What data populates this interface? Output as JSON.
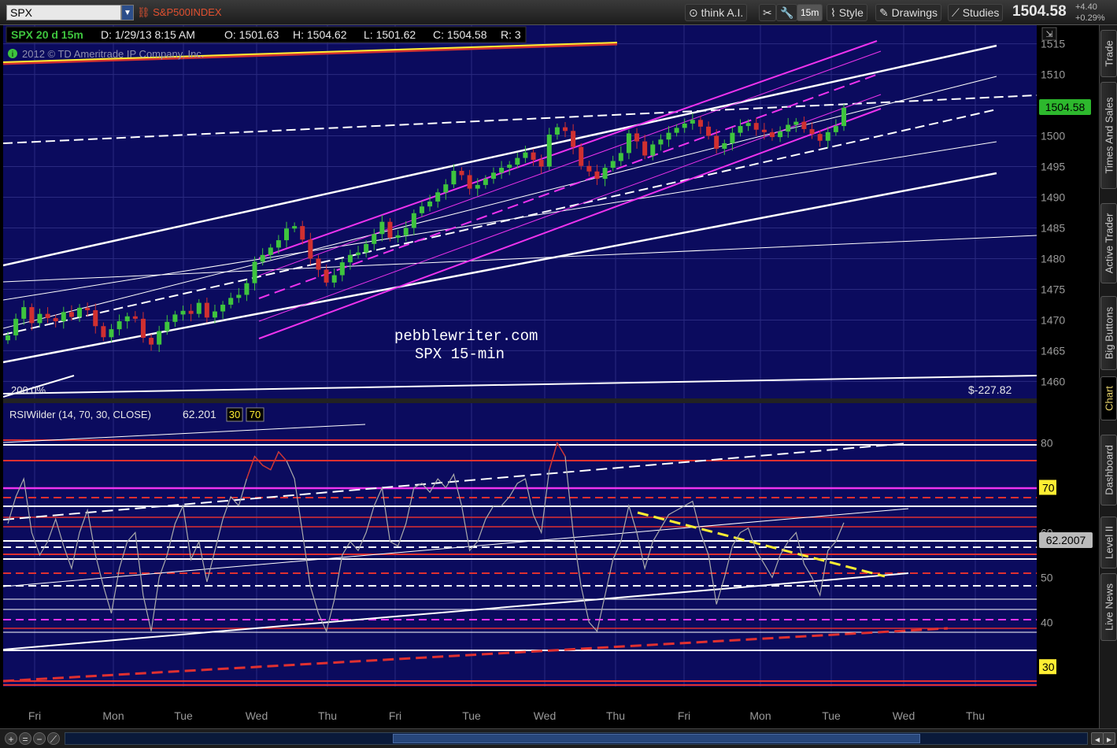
{
  "toolbar": {
    "symbol": "SPX",
    "symbol_description": "S&P500INDEX",
    "think_ai": "think A.I.",
    "interval": "15m",
    "style": "Style",
    "drawings": "Drawings",
    "studies": "Studies",
    "last_price": "1504.58",
    "change_abs": "+4.40",
    "change_pct": "+0.29%"
  },
  "price_header": {
    "label": "SPX 20 d 15m",
    "date": "D: 1/29/13 8:15 AM",
    "open": "O: 1501.63",
    "high": "H: 1504.62",
    "low": "L: 1501.62",
    "close": "C: 1504.58",
    "r": "R: 3"
  },
  "copyright": "2012 © TD Ameritrade IP Company, Inc.",
  "watermark": {
    "line1": "pebblewriter.com",
    "line2": "SPX 15-min"
  },
  "zoom_label": "200.0%",
  "pl_label": "$-227.82",
  "price_axis": {
    "ticks": [
      "1515",
      "1510",
      "1505",
      "1500",
      "1495",
      "1490",
      "1485",
      "1480",
      "1475",
      "1470",
      "1465",
      "1460"
    ],
    "current_tag": "1504.58"
  },
  "rsi_header": {
    "label": "RSIWilder (14, 70, 30, CLOSE)",
    "value": "62.201",
    "oversold": "30",
    "overbought": "70"
  },
  "rsi_axis": {
    "ticks": [
      "80",
      "70",
      "60",
      "50",
      "40",
      "30"
    ],
    "current_tag": "62.2007"
  },
  "time_axis": [
    "Fri",
    "Mon",
    "Tue",
    "Wed",
    "Thu",
    "Fri",
    "Tue",
    "Wed",
    "Thu",
    "Fri",
    "Mon",
    "Tue",
    "Wed",
    "Thu"
  ],
  "side_tabs": [
    "Trade",
    "Times And Sales",
    "Active Trader",
    "Big Buttons",
    "Chart",
    "Dashboard",
    "Level II",
    "Live News"
  ],
  "colors": {
    "price_bg": "#0b0b5e",
    "rsi_bg": "#0b0b5e",
    "up_candle": "#3ec43e",
    "down_candle": "#d03030",
    "channel": "#ee33ee",
    "trendline": "#ffffff",
    "rsi_line": "#aaaaaa",
    "yellow_line": "#ffee33",
    "price_tag": "#2db82d",
    "rsi_tag": "#bbbbbb"
  },
  "chart_data": {
    "type": "candlestick",
    "title": "SPX 20 d 15m",
    "price_range": [
      1458,
      1517
    ],
    "rsi_range": [
      26,
      88
    ],
    "closes": [
      1467.5,
      1470.2,
      1472.1,
      1469.5,
      1471.0,
      1470.3,
      1469.8,
      1471.3,
      1470.5,
      1472.0,
      1471.6,
      1469.0,
      1467.2,
      1468.5,
      1469.8,
      1470.6,
      1470.2,
      1467.1,
      1466.0,
      1468.2,
      1469.7,
      1470.9,
      1471.5,
      1471.0,
      1472.8,
      1470.4,
      1471.4,
      1472.5,
      1473.6,
      1474.1,
      1476.0,
      1479.5,
      1480.6,
      1481.8,
      1483.0,
      1484.9,
      1485.3,
      1483.1,
      1480.0,
      1478.2,
      1476.1,
      1477.3,
      1479.4,
      1480.6,
      1481.0,
      1482.4,
      1484.0,
      1486.0,
      1483.4,
      1483.8,
      1485.0,
      1487.4,
      1488.5,
      1489.3,
      1490.8,
      1492.1,
      1494.3,
      1493.6,
      1491.4,
      1492.0,
      1493.0,
      1494.0,
      1494.8,
      1495.3,
      1496.4,
      1497.3,
      1496.1,
      1495.0,
      1500.2,
      1501.4,
      1500.8,
      1498.2,
      1495.1,
      1494.2,
      1493.0,
      1494.8,
      1495.9,
      1497.2,
      1500.4,
      1499.1,
      1496.8,
      1498.6,
      1499.4,
      1500.5,
      1501.3,
      1502.0,
      1502.6,
      1501.5,
      1500.0,
      1497.9,
      1498.8,
      1500.5,
      1501.6,
      1502.1,
      1501.0,
      1500.6,
      1499.8,
      1500.7,
      1501.8,
      1502.3,
      1501.1,
      1500.3,
      1499.2,
      1500.6,
      1501.6,
      1504.58
    ],
    "rsi_values": [
      62,
      68,
      72,
      60,
      55,
      58,
      63,
      57,
      52,
      60,
      65,
      55,
      48,
      42,
      52,
      58,
      60,
      46,
      38,
      50,
      55,
      62,
      66,
      54,
      58,
      49,
      56,
      63,
      68,
      66,
      72,
      77,
      75,
      74,
      78,
      76,
      72,
      60,
      48,
      42,
      38,
      45,
      55,
      58,
      56,
      60,
      66,
      70,
      58,
      57,
      62,
      70,
      71,
      69,
      72,
      70,
      73,
      66,
      56,
      58,
      63,
      66,
      66,
      68,
      71,
      72,
      64,
      60,
      74,
      80,
      77,
      60,
      48,
      40,
      38,
      46,
      54,
      58,
      66,
      60,
      52,
      58,
      61,
      64,
      65,
      66,
      67,
      60,
      55,
      44,
      50,
      57,
      60,
      61,
      56,
      53,
      50,
      55,
      58,
      60,
      53,
      50,
      46,
      56,
      58,
      62.2
    ],
    "time_labels": [
      "Fri",
      "Mon",
      "Tue",
      "Wed",
      "Thu",
      "Fri",
      "Tue",
      "Wed",
      "Thu",
      "Fri",
      "Mon",
      "Tue",
      "Wed",
      "Thu"
    ]
  }
}
